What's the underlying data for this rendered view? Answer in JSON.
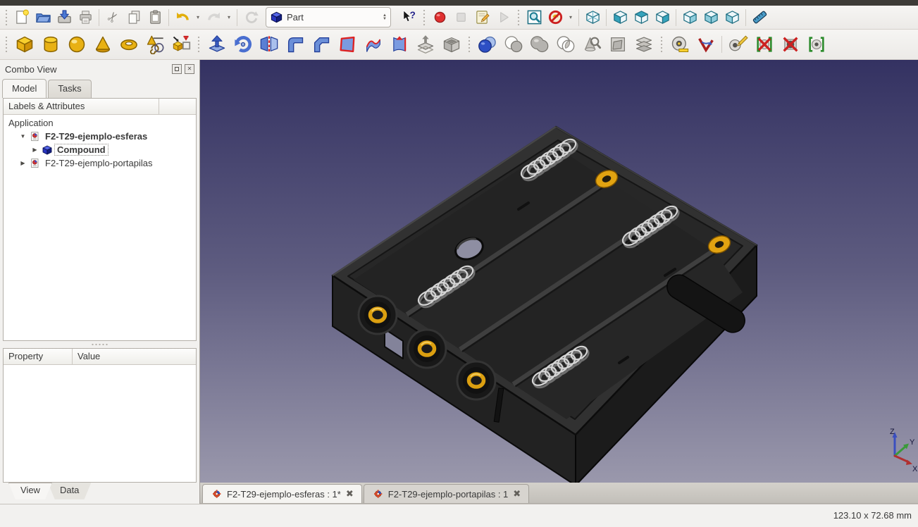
{
  "toolbars": {
    "standard": [
      {
        "type": "handle"
      },
      {
        "name": "new",
        "icon": "page-new"
      },
      {
        "name": "open",
        "icon": "folder-open"
      },
      {
        "name": "save",
        "icon": "save"
      },
      {
        "name": "print",
        "icon": "printer"
      },
      {
        "type": "sep"
      },
      {
        "name": "cut",
        "icon": "scissors"
      },
      {
        "name": "copy",
        "icon": "copy"
      },
      {
        "name": "paste",
        "icon": "clipboard"
      },
      {
        "type": "sep"
      },
      {
        "name": "undo",
        "icon": "undo-arrow"
      },
      {
        "type": "caret",
        "name": "undo-history"
      },
      {
        "name": "redo",
        "icon": "redo-arrow",
        "disabled": true
      },
      {
        "type": "caret",
        "name": "redo-history"
      },
      {
        "type": "sep"
      },
      {
        "name": "refresh",
        "icon": "refresh",
        "disabled": true
      },
      {
        "type": "combo",
        "name": "workbench-selector",
        "icon": "cube-blue",
        "value": "Part"
      },
      {
        "name": "whats-this",
        "icon": "help-cursor"
      },
      {
        "type": "handle"
      },
      {
        "name": "macro-record",
        "icon": "record-dot"
      },
      {
        "name": "macro-stop",
        "icon": "stop-square",
        "disabled": true
      },
      {
        "name": "macro-edit",
        "icon": "edit-macro"
      },
      {
        "name": "macro-play",
        "icon": "play-triangle",
        "disabled": true
      },
      {
        "type": "handle"
      },
      {
        "name": "fit-all",
        "icon": "zoom-fit"
      },
      {
        "name": "draw-style",
        "icon": "draw-style"
      },
      {
        "type": "caret",
        "name": "draw-style-menu"
      },
      {
        "type": "sep"
      },
      {
        "name": "view-isometric",
        "icon": "cube-wire"
      },
      {
        "type": "sep"
      },
      {
        "name": "view-front",
        "icon": "cube-front"
      },
      {
        "name": "view-top",
        "icon": "cube-top"
      },
      {
        "name": "view-right",
        "icon": "cube-right"
      },
      {
        "type": "sep"
      },
      {
        "name": "view-rear",
        "icon": "cube-rear"
      },
      {
        "name": "view-bottom",
        "icon": "cube-bottom"
      },
      {
        "name": "view-left",
        "icon": "cube-left"
      },
      {
        "type": "sep"
      },
      {
        "name": "measure-distance",
        "icon": "ruler"
      }
    ],
    "part": [
      {
        "type": "handle"
      },
      {
        "name": "box",
        "icon": "box-yellow"
      },
      {
        "name": "cylinder",
        "icon": "cylinder-yellow"
      },
      {
        "name": "sphere",
        "icon": "sphere-yellow"
      },
      {
        "name": "cone",
        "icon": "cone-yellow"
      },
      {
        "name": "torus",
        "icon": "torus-yellow"
      },
      {
        "name": "primitives",
        "icon": "primitives"
      },
      {
        "name": "shape-builder",
        "icon": "shape-builder"
      },
      {
        "type": "handle"
      },
      {
        "name": "extrude",
        "icon": "extrude"
      },
      {
        "name": "revolve",
        "icon": "revolve"
      },
      {
        "name": "mirror",
        "icon": "mirror"
      },
      {
        "name": "fillet",
        "icon": "fillet"
      },
      {
        "name": "chamfer",
        "icon": "chamfer"
      },
      {
        "name": "make-face",
        "icon": "make-face"
      },
      {
        "name": "ruled-surface",
        "icon": "ruled-surface"
      },
      {
        "name": "loft",
        "icon": "loft"
      },
      {
        "name": "offset",
        "icon": "offset"
      },
      {
        "name": "thickness",
        "icon": "thickness"
      },
      {
        "type": "handle"
      },
      {
        "name": "boolean",
        "icon": "boolean"
      },
      {
        "name": "cut-boolean",
        "icon": "cut-boolean"
      },
      {
        "name": "union",
        "icon": "union"
      },
      {
        "name": "intersection",
        "icon": "intersection"
      },
      {
        "name": "check-geometry",
        "icon": "check-geometry"
      },
      {
        "name": "defeaturing",
        "icon": "defeaturing"
      },
      {
        "name": "cross-sections",
        "icon": "cross-sections"
      },
      {
        "type": "handle"
      },
      {
        "name": "measure-linear",
        "icon": "measure-linear"
      },
      {
        "name": "measure-angular",
        "icon": "measure-angular"
      },
      {
        "type": "sep"
      },
      {
        "name": "measure-refresh",
        "icon": "measure-refresh"
      },
      {
        "name": "measure-clear-all",
        "icon": "measure-clear-all"
      },
      {
        "name": "measure-toggle-all",
        "icon": "measure-toggle-all"
      },
      {
        "name": "measure-toggle-3d",
        "icon": "measure-toggle-3d"
      }
    ]
  },
  "workbench": {
    "value": "Part"
  },
  "combo_view": {
    "title": "Combo View",
    "tabs": [
      {
        "label": "Model",
        "active": true
      },
      {
        "label": "Tasks",
        "active": false
      }
    ],
    "tree_header": "Labels & Attributes",
    "tree": {
      "items": [
        {
          "label": "Application",
          "depth": 0
        },
        {
          "label": "F2-T29-ejemplo-esferas",
          "depth": 1,
          "icon": "freecad-doc",
          "bold": true,
          "expander": "expanded"
        },
        {
          "label": "Compound",
          "depth": 2,
          "icon": "compound-cube",
          "bold": true,
          "expander": "collapsed",
          "focused": true
        },
        {
          "label": "F2-T29-ejemplo-portapilas",
          "depth": 1,
          "icon": "freecad-doc",
          "bold": false,
          "expander": "collapsed"
        }
      ]
    },
    "property_table": {
      "columns": [
        "Property",
        "Value"
      ],
      "rows": []
    },
    "bottom_tabs": [
      {
        "label": "View",
        "active": true
      },
      {
        "label": "Data",
        "active": false
      }
    ]
  },
  "viewport": {
    "gradient_top": "#343262",
    "gradient_bottom": "#9a98ac",
    "model_body_color": "#2b2b2b",
    "spring_color": "#d4d4d4",
    "contact_gold_color": "#e0a311",
    "axis": {
      "x": "X",
      "y": "Y",
      "z": "Z"
    }
  },
  "mdi_tabs": [
    {
      "label": "F2-T29-ejemplo-esferas : 1*",
      "active": true
    },
    {
      "label": "F2-T29-ejemplo-portapilas : 1",
      "active": false
    }
  ],
  "status_bar": {
    "dimensions": "123.10 x 72.68 mm"
  }
}
